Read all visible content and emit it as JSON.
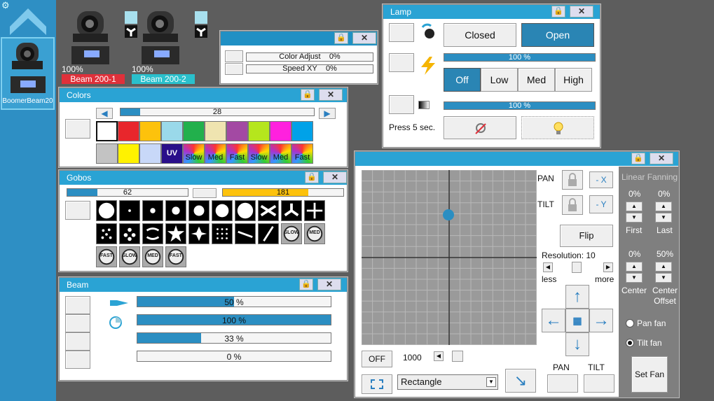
{
  "sidebar": {
    "fixture_label": "BoomerBeam20"
  },
  "fixtures": [
    {
      "percent": "100%",
      "name": "Beam 200-1",
      "color": "#e0303a"
    },
    {
      "percent": "100%",
      "name": "Beam 200-2",
      "color": "#2ac0cc"
    }
  ],
  "small_window": {
    "rows": [
      {
        "label": "Color Adjust",
        "value": "0%"
      },
      {
        "label": "Speed XY",
        "value": "0%"
      }
    ]
  },
  "colors": {
    "title": "Colors",
    "slider_value": "28",
    "slider_fraction": 0.1,
    "swatches_row1": [
      "#ffffff",
      "#e8262c",
      "#fdc20c",
      "#9ad9ea",
      "#22b04c",
      "#efe4b0",
      "#a349a3",
      "#b5e61d",
      "#ff21de",
      "#00a2e8"
    ],
    "swatches_row2": [
      "#c3c3c3",
      "#fff200",
      "#c8d8f8"
    ],
    "uv_label": "UV",
    "rainbow_labels": [
      "Slow",
      "Med",
      "Fast",
      "Slow",
      "Med",
      "Fast"
    ]
  },
  "gobos": {
    "title": "Gobos",
    "slider1_value": "62",
    "slider1_fraction": 0.25,
    "slider2_value": "181",
    "slider2_fraction": 0.71,
    "slow_label": "SLOW",
    "med_label": "MED",
    "fast_label": "FAST"
  },
  "beam": {
    "title": "Beam",
    "bars": [
      {
        "value": "50 %",
        "fraction": 0.5
      },
      {
        "value": "100 %",
        "fraction": 1.0
      },
      {
        "value": "33 %",
        "fraction": 0.33
      },
      {
        "value": "0 %",
        "fraction": 0.0
      }
    ]
  },
  "lamp": {
    "title": "Lamp",
    "closed_label": "Closed",
    "open_label": "Open",
    "bar1_value": "100 %",
    "bar1_fraction": 1.0,
    "dimmer_buttons": [
      "Off",
      "Low",
      "Med",
      "High"
    ],
    "bar2_value": "100 %",
    "bar2_fraction": 1.0,
    "press_label": "Press 5 sec."
  },
  "position": {
    "pan_label": "PAN",
    "tilt_label": "TILT",
    "minus_x": "- X",
    "minus_y": "- Y",
    "flip_label": "Flip",
    "resolution_label": "Resolution: 10",
    "less_label": "less",
    "more_label": "more",
    "off_label": "OFF",
    "speed_value": "1000",
    "shape_value": "Rectangle",
    "pan_bottom": "PAN",
    "tilt_bottom": "TILT",
    "fanning": {
      "title": "Linear Fanning",
      "first_value": "0%",
      "last_value": "0%",
      "first_label": "First",
      "last_label": "Last",
      "center_value": "0%",
      "offset_value": "50%",
      "center_label": "Center",
      "offset_label": "Center Offset",
      "pan_fan": "Pan fan",
      "tilt_fan": "Tilt fan",
      "set_fan": "Set Fan"
    }
  }
}
